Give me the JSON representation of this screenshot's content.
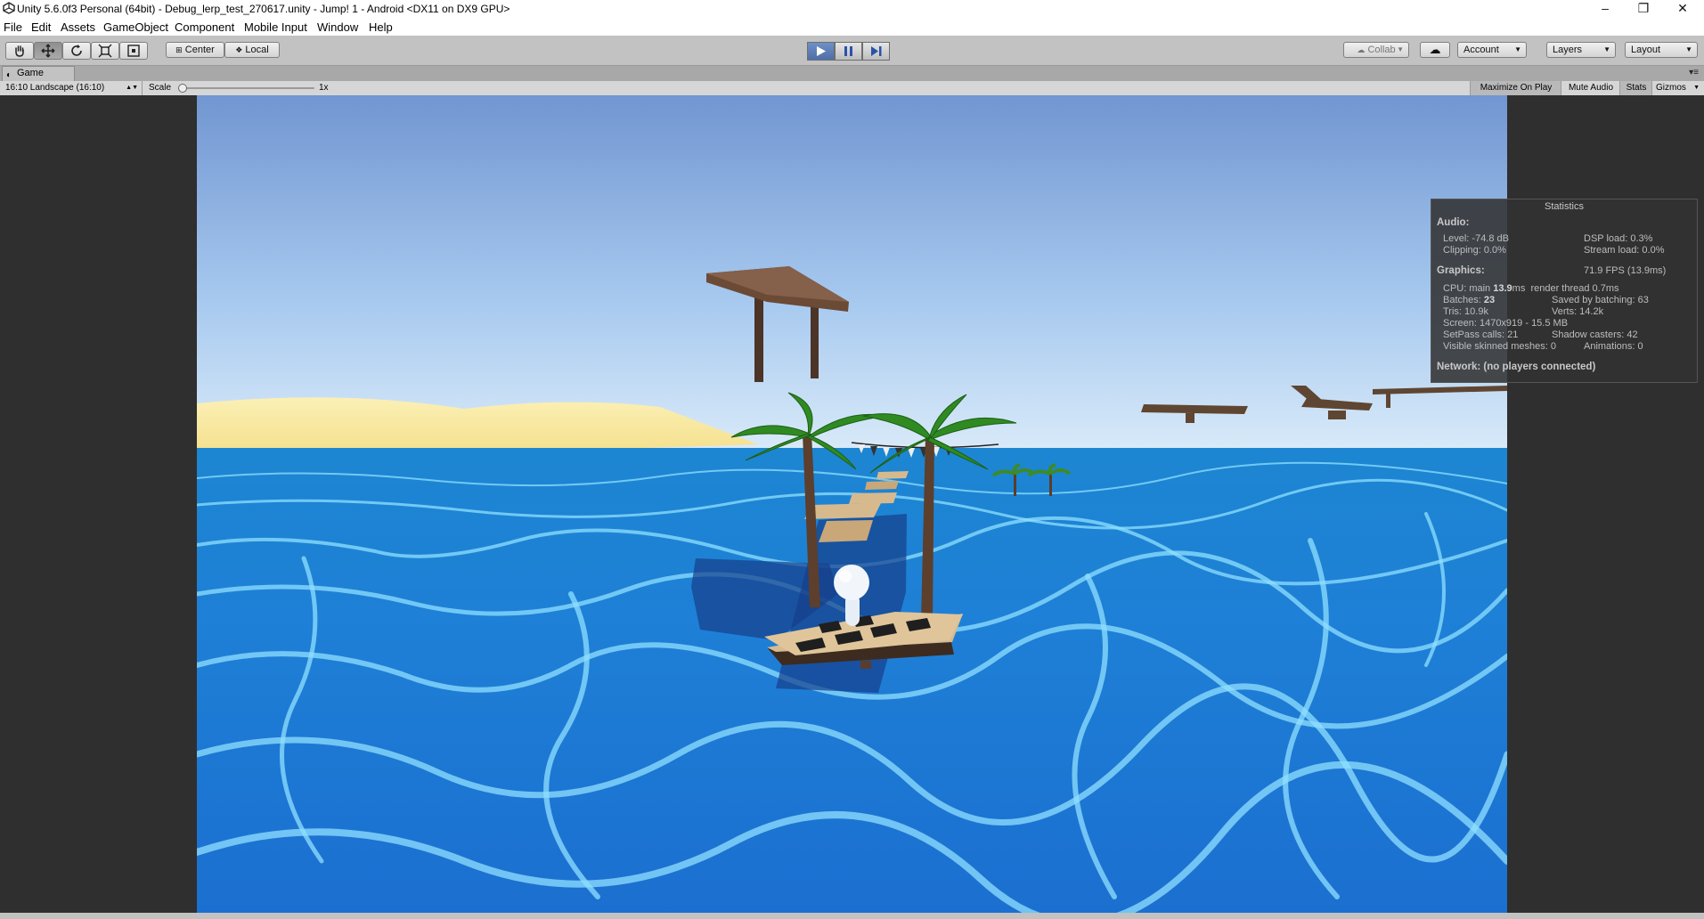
{
  "window": {
    "title": "Unity 5.6.0f3 Personal (64bit) - Debug_lerp_test_270617.unity - Jump! 1 - Android <DX11 on DX9 GPU>",
    "controls": {
      "minimize": "–",
      "maximize": "❐",
      "close": "✕"
    }
  },
  "menu": [
    "File",
    "Edit",
    "Assets",
    "GameObject",
    "Component",
    "Mobile Input",
    "Window",
    "Help"
  ],
  "toolbar": {
    "tools": [
      "hand-tool",
      "move-tool",
      "rotate-tool",
      "scale-tool",
      "rect-tool"
    ],
    "pivot_label": "Center",
    "space_label": "Local",
    "collab_label": "Collab",
    "account_label": "Account",
    "layers_label": "Layers",
    "layout_label": "Layout",
    "colors": {
      "play_active": "#4e6fa6"
    }
  },
  "game_view": {
    "tab_label": "Game",
    "resolution": "16:10 Landscape (16:10)",
    "scale_label": "Scale",
    "scale_value": "1x",
    "maximize_label": "Maximize On Play",
    "mute_label": "Mute Audio",
    "stats_label": "Stats",
    "gizmos_label": "Gizmos"
  },
  "statistics": {
    "header": "Statistics",
    "audio_label": "Audio:",
    "level": "Level: -74.8 dB",
    "dsp_load": "DSP load: 0.3%",
    "clipping": "Clipping: 0.0%",
    "stream_load": "Stream load: 0.0%",
    "graphics_label": "Graphics:",
    "fps": "71.9 FPS (13.9ms)",
    "cpu_prefix": "CPU: main ",
    "cpu_main": "13.9",
    "cpu_suffix": "ms  render thread 0.7ms",
    "batches_prefix": "Batches: ",
    "batches_value": "23",
    "saved_by_batching": "Saved by batching: 63",
    "tris": "Tris: 10.9k",
    "verts": "Verts: 14.2k",
    "screen": "Screen: 1470x919 - 15.5 MB",
    "setpass": "SetPass calls: 21",
    "shadow_casters": "Shadow casters: 42",
    "visible_skinned": "Visible skinned meshes: 0",
    "animations": "Animations: 0",
    "network": "Network: (no players connected)"
  }
}
